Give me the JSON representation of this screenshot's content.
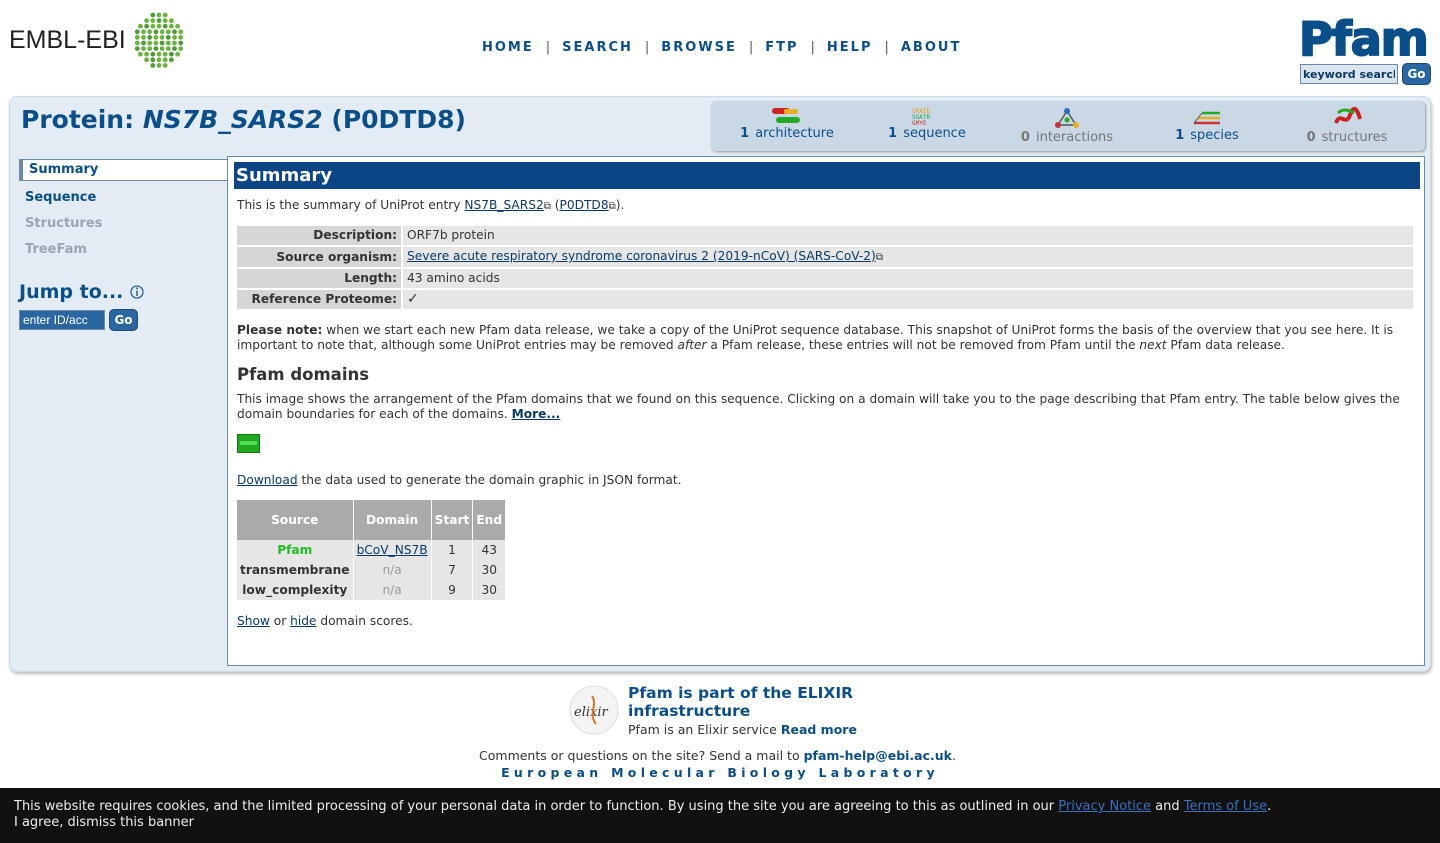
{
  "header": {
    "embl_logo_text": "EMBL-EBI",
    "nav": [
      "HOME",
      "SEARCH",
      "BROWSE",
      "FTP",
      "HELP",
      "ABOUT"
    ],
    "pfam_logo_text": "Pfam",
    "keyword_search_value": "keyword search",
    "go_label": "Go"
  },
  "page": {
    "title_prefix": "Protein: ",
    "title_id": "NS7B_SARS2",
    "title_acc": " (P0DTD8)"
  },
  "summary_bar": [
    {
      "count": "1",
      "label": "architecture",
      "icon": "architecture-icon"
    },
    {
      "count": "1",
      "label": "sequence",
      "icon": "sequence-icon"
    },
    {
      "count": "0",
      "label": "interactions",
      "icon": "interactions-icon"
    },
    {
      "count": "1",
      "label": "species",
      "icon": "species-icon"
    },
    {
      "count": "0",
      "label": "structures",
      "icon": "structures-icon"
    }
  ],
  "sidebar": {
    "tabs": [
      "Summary",
      "Sequence",
      "Structures",
      "TreeFam"
    ],
    "jump_title": "Jump to...",
    "jump_placeholder": "enter ID/acc",
    "go_label": "Go"
  },
  "summary": {
    "heading": "Summary",
    "intro_pre": "This is the summary of UniProt entry ",
    "intro_id": "NS7B_SARS2",
    "intro_mid": " (",
    "intro_acc": "P0DTD8",
    "intro_post": ").",
    "props": [
      {
        "label": "Description:",
        "value": "ORF7b protein"
      },
      {
        "label": "Source organism:",
        "value": "Severe acute respiratory syndrome coronavirus 2 (2019-nCoV) (SARS-CoV-2)"
      },
      {
        "label": "Length:",
        "value": "43 amino acids"
      },
      {
        "label": "Reference Proteome:",
        "value": "✓"
      }
    ],
    "note_bold": "Please note:",
    "note_1": " when we start each new Pfam data release, we take a copy of the UniProt sequence database. This snapshot of UniProt forms the basis of the overview that you see here. It is important to note that, although some UniProt entries may be removed ",
    "note_after": "after",
    "note_2": " a Pfam release, these entries will not be removed from Pfam until the ",
    "note_next": "next",
    "note_3": " Pfam data release.",
    "domains_heading": "Pfam domains",
    "domains_text": "This image shows the arrangement of the Pfam domains that we found on this sequence. Clicking on a domain will take you to the page describing that Pfam entry. The table below gives the domain boundaries for each of the domains. ",
    "more_label": "More...",
    "download_label": "Download",
    "download_text": " the data used to generate the domain graphic in JSON format.",
    "table_headers": [
      "Source",
      "Domain",
      "Start",
      "End"
    ],
    "table_rows": [
      {
        "source": "Pfam",
        "domain": "bCoV_NS7B",
        "start": "1",
        "end": "43"
      },
      {
        "source": "transmembrane",
        "domain": "n/a",
        "start": "7",
        "end": "30"
      },
      {
        "source": "low_complexity",
        "domain": "n/a",
        "start": "9",
        "end": "30"
      }
    ],
    "show_label": "Show",
    "or_text": " or ",
    "hide_label": "hide",
    "scores_text": " domain scores."
  },
  "footer": {
    "elixir_title": "Pfam is part of the ELIXIR infrastructure",
    "elixir_sub": "Pfam is an Elixir service ",
    "read_more": "Read more",
    "comments_pre": "Comments or questions on the site? Send a mail to ",
    "email": "pfam-help@ebi.ac.uk",
    "comments_post": ".",
    "embl_name": "European Molecular Biology Laboratory"
  },
  "cookie": {
    "text_1": "This website requires cookies, and the limited processing of your personal data in order to function. By using the site you are agreeing to this as outlined in our ",
    "privacy": "Privacy Notice",
    "and": " and ",
    "terms": "Terms of Use",
    "period": ".",
    "dismiss": "I agree, dismiss this banner"
  },
  "colors": {
    "brand_blue": "#0b4f8a",
    "panel_bg": "#e3ebf4",
    "heading_bar": "#0b4586",
    "pfam_green": "#22bb22"
  }
}
